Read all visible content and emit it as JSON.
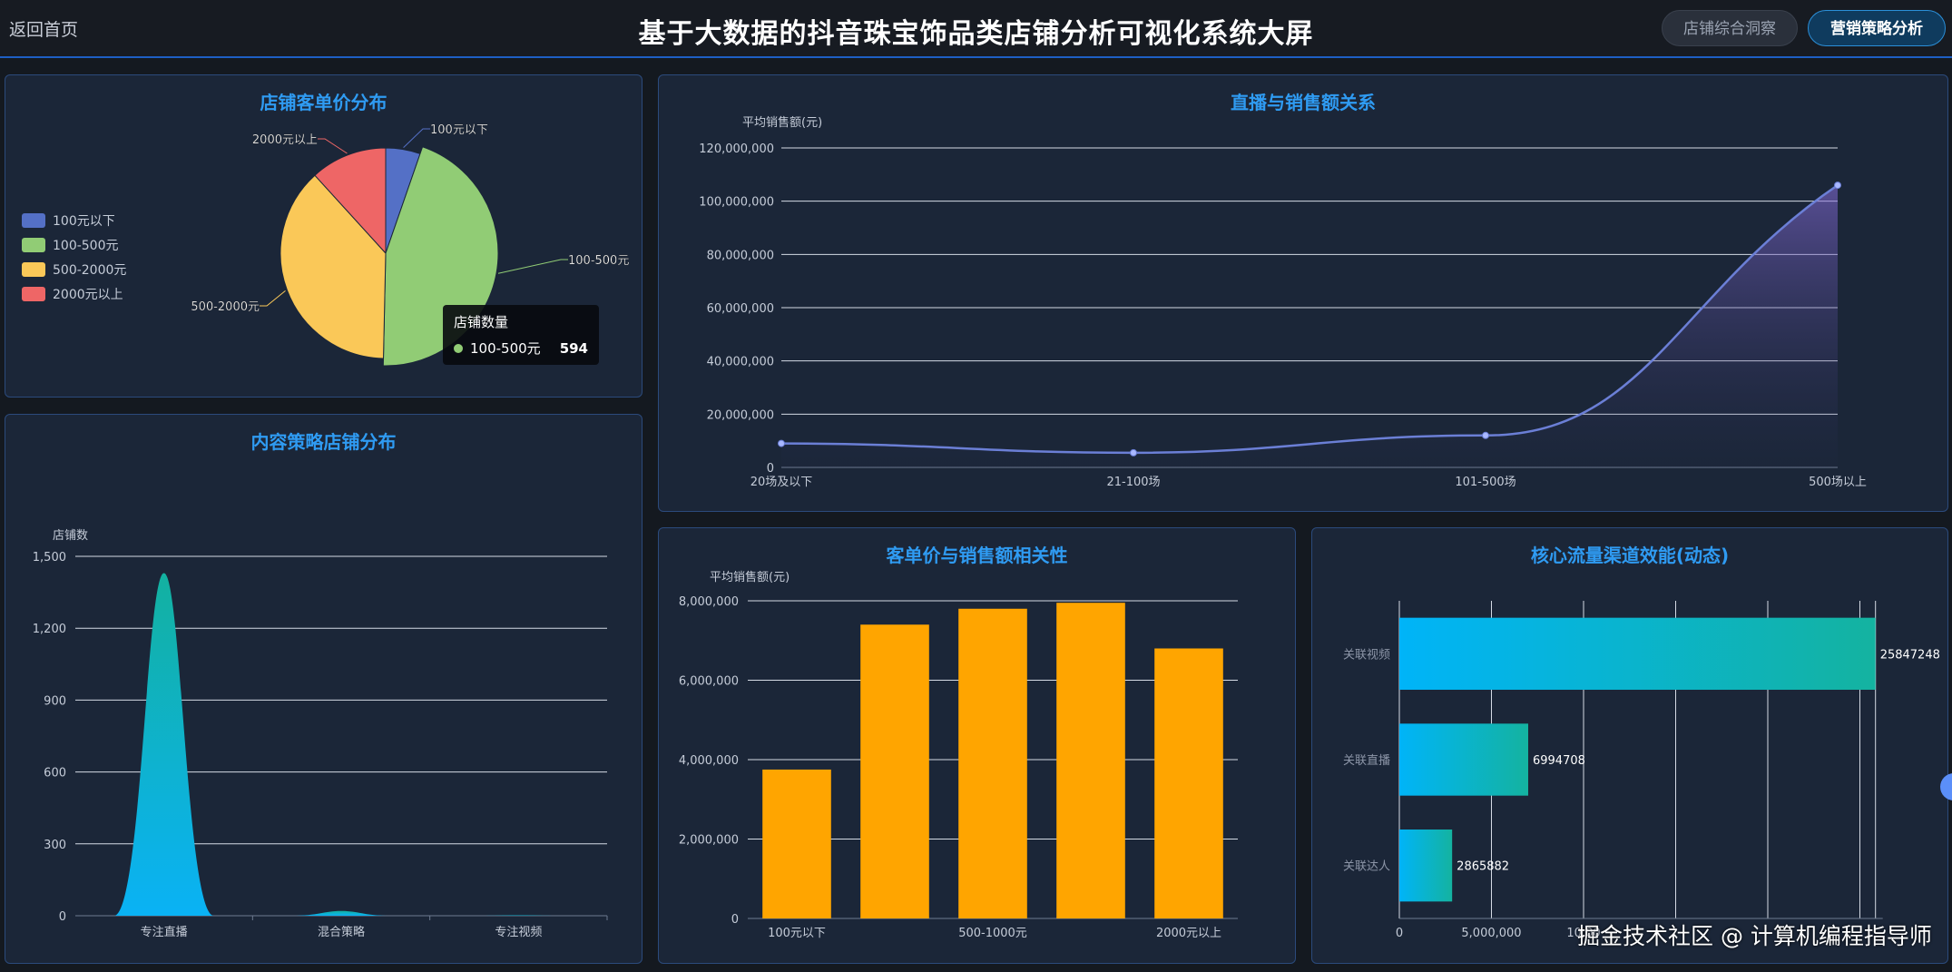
{
  "header": {
    "back_label": "返回首页",
    "title": "基于大数据的抖音珠宝饰品类店铺分析可视化系统大屏",
    "nav": [
      "店铺综合洞察",
      "营销策略分析"
    ]
  },
  "pie_panel": {
    "title": "店铺客单价分布",
    "tooltip": {
      "title": "店铺数量",
      "label": "100-500元",
      "value": "594"
    }
  },
  "line_panel": {
    "title": "直播与销售额关系"
  },
  "area_panel": {
    "title": "内容策略店铺分布"
  },
  "bar_panel": {
    "title": "客单价与销售额相关性"
  },
  "hbar_panel": {
    "title": "核心流量渠道效能(动态)"
  },
  "watermark": "掘金技术社区 @ 计算机编程指导师",
  "chart_data": [
    {
      "type": "pie",
      "title": "店铺客单价分布",
      "legend_position": "top-left",
      "categories": [
        "100元以下",
        "100-500元",
        "500-2000元",
        "2000元以上"
      ],
      "values": [
        70,
        594,
        500,
        155
      ],
      "colors": [
        "#5470c6",
        "#91cc75",
        "#fac858",
        "#ee6666"
      ]
    },
    {
      "type": "line",
      "title": "直播与销售额关系",
      "ylabel": "平均销售额(元)",
      "ylim": [
        0,
        120000000
      ],
      "yticks": [
        0,
        20000000,
        40000000,
        60000000,
        80000000,
        100000000,
        120000000
      ],
      "ytick_labels": [
        "0",
        "20,000,000",
        "40,000,000",
        "60,000,000",
        "80,000,000",
        "100,000,000",
        "120,000,000"
      ],
      "categories": [
        "20场及以下",
        "21-100场",
        "101-500场",
        "500场以上"
      ],
      "values": [
        9000000,
        5500000,
        12000000,
        106000000
      ],
      "color": "#6b7fd6",
      "grid": true
    },
    {
      "type": "area",
      "title": "内容策略店铺分布",
      "ylabel": "店铺数",
      "ylim": [
        0,
        1500
      ],
      "yticks": [
        0,
        300,
        600,
        900,
        1200,
        1500
      ],
      "ytick_labels": [
        "0",
        "300",
        "600",
        "900",
        "1,200",
        "1,500"
      ],
      "categories": [
        "专注直播",
        "混合策略",
        "专注视频"
      ],
      "values": [
        1430,
        20,
        2
      ],
      "grid": true
    },
    {
      "type": "bar",
      "title": "客单价与销售额相关性",
      "ylabel": "平均销售额(元)",
      "ylim": [
        0,
        8000000
      ],
      "yticks": [
        0,
        2000000,
        4000000,
        6000000,
        8000000
      ],
      "ytick_labels": [
        "0",
        "2,000,000",
        "4,000,000",
        "6,000,000",
        "8,000,000"
      ],
      "categories": [
        "100元以下",
        "",
        "500-1000元",
        "",
        "2000元以上"
      ],
      "values": [
        3750000,
        7400000,
        7800000,
        7950000,
        6800000
      ],
      "color": "#ffa500",
      "grid": true
    },
    {
      "type": "bar",
      "orientation": "horizontal",
      "title": "核心流量渠道效能(动态)",
      "categories": [
        "关联视频",
        "关联直播",
        "关联达人"
      ],
      "values": [
        25847248,
        6994708,
        2865882
      ],
      "value_labels": [
        "25847248",
        "6994708",
        "2865882"
      ],
      "xticks": [
        0,
        5000000,
        10000000
      ],
      "xtick_labels": [
        "0",
        "5,000,000",
        "10,00"
      ],
      "grid": true
    }
  ]
}
